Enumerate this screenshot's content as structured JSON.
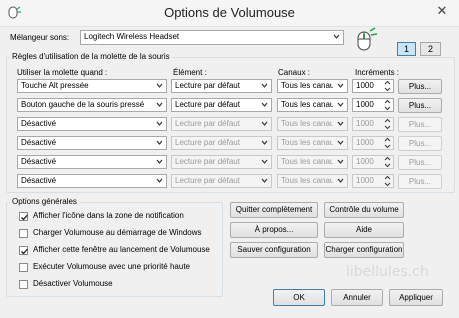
{
  "window": {
    "title": "Options de Volumouse",
    "close_glyph": "✕"
  },
  "mixer": {
    "label": "Mélangeur sons:",
    "value": "Logitech Wireless Headset"
  },
  "rules": {
    "title": "Règles d'utilisation de la molette de la souris",
    "headers": {
      "when": "Utiliser la molette quand :",
      "element": "Élément :",
      "channels": "Canaux :",
      "increments": "Incréments :"
    },
    "page_buttons": [
      "1",
      "2"
    ],
    "more_label": "Plus...",
    "rows": [
      {
        "when": "Touche Alt pressée",
        "element": "Lecture par défaut",
        "channels": "Tous les canaux",
        "increment": "1000",
        "enabled": true
      },
      {
        "when": "Bouton gauche de la souris pressé",
        "element": "Lecture par défaut",
        "channels": "Tous les canaux",
        "increment": "1000",
        "enabled": true
      },
      {
        "when": "Désactivé",
        "element": "Lecture par défaut",
        "channels": "Tous les canaux",
        "increment": "1000",
        "enabled": false
      },
      {
        "when": "Désactivé",
        "element": "Lecture par défaut",
        "channels": "Tous les canaux",
        "increment": "1000",
        "enabled": false
      },
      {
        "when": "Désactivé",
        "element": "Lecture par défaut",
        "channels": "Tous les canaux",
        "increment": "1000",
        "enabled": false
      },
      {
        "when": "Désactivé",
        "element": "Lecture par défaut",
        "channels": "Tous les canaux",
        "increment": "1000",
        "enabled": false
      }
    ]
  },
  "general": {
    "title": "Options générales",
    "options": [
      {
        "label": "Afficher l'icône dans la zone de notification",
        "checked": true
      },
      {
        "label": "Charger Volumouse au démarrage de Windows",
        "checked": false
      },
      {
        "label": "Afficher cette fenêtre au lancement de Volumouse",
        "checked": true
      },
      {
        "label": "Exécuter Volumouse avec une priorité haute",
        "checked": false
      },
      {
        "label": "Désactiver Volumouse",
        "checked": false
      }
    ]
  },
  "actions": {
    "quit_all": "Quitter complètement",
    "volume_control": "Contrôle du volume",
    "about": "À propos...",
    "help": "Aide",
    "save_config": "Sauver configuration",
    "load_config": "Charger configuration"
  },
  "dialog": {
    "ok": "OK",
    "cancel": "Annuler",
    "apply": "Appliquer"
  },
  "watermark": "libellules.ch"
}
